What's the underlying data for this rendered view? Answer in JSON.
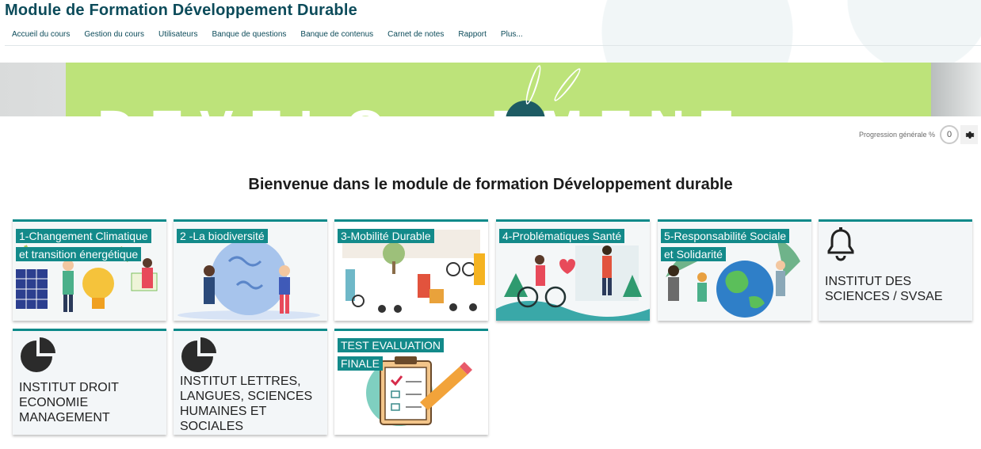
{
  "header": {
    "course_title": "Module de Formation Développement Durable",
    "nav": [
      {
        "label": "Accueil du cours"
      },
      {
        "label": "Gestion du cours"
      },
      {
        "label": "Utilisateurs"
      },
      {
        "label": "Banque de questions"
      },
      {
        "label": "Banque de contenus"
      },
      {
        "label": "Carnet de notes"
      },
      {
        "label": "Rapport"
      },
      {
        "label": "Plus..."
      }
    ]
  },
  "progress": {
    "label": "Progression générale %",
    "value": "0"
  },
  "welcome": "Bienvenue dans le module de formation Développement durable",
  "tiles": [
    {
      "line1": "1-Changement Climatique",
      "line2": "et transition énergétique"
    },
    {
      "line1": "2 -La biodiversité"
    },
    {
      "line1": "3-Mobilité Durable"
    },
    {
      "line1": "4-Problématiques Santé"
    },
    {
      "line1": "5-Responsabilité Sociale",
      "line2": "et Solidarité"
    },
    {
      "text": "INSTITUT DES SCIENCES / SVSAE"
    },
    {
      "text": "INSTITUT DROIT ECONOMIE MANAGEMENT"
    },
    {
      "text": "INSTITUT LETTRES, LANGUES, SCIENCES HUMAINES ET SOCIALES"
    },
    {
      "line1": "TEST EVALUATION",
      "line2": "FINALE"
    }
  ],
  "colors": {
    "accent": "#138a8a",
    "title": "#0c4b5a",
    "banner": "#bde37a"
  },
  "icons": [
    "gear-icon",
    "bell-icon",
    "pie-chart-icon",
    "clipboard-check-icon"
  ]
}
